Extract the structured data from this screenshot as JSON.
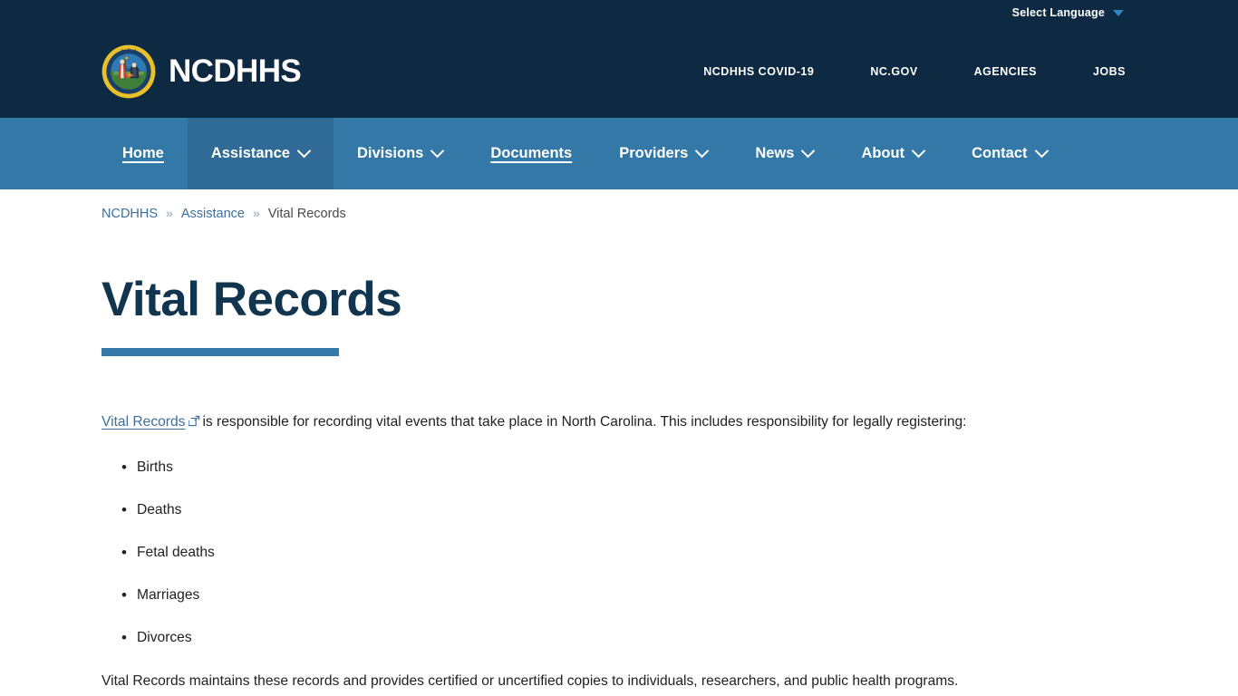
{
  "utility": {
    "language_label": "Select Language",
    "caret_icon": "chevron-down-icon"
  },
  "masthead": {
    "brand_name": "NCDHHS",
    "seal_icon": "north-carolina-state-seal-icon",
    "top_links": [
      {
        "label": "NCDHHS COVID-19"
      },
      {
        "label": "NC.GOV"
      },
      {
        "label": "AGENCIES"
      },
      {
        "label": "JOBS"
      }
    ]
  },
  "mainnav": {
    "items": [
      {
        "label": "Home",
        "has_caret": false,
        "active": false,
        "underline": true
      },
      {
        "label": "Assistance",
        "has_caret": true,
        "active": true,
        "underline": false
      },
      {
        "label": "Divisions",
        "has_caret": true,
        "active": false,
        "underline": false
      },
      {
        "label": "Documents",
        "has_caret": false,
        "active": false,
        "underline": true
      },
      {
        "label": "Providers",
        "has_caret": true,
        "active": false,
        "underline": false
      },
      {
        "label": "News",
        "has_caret": true,
        "active": false,
        "underline": false
      },
      {
        "label": "About",
        "has_caret": true,
        "active": false,
        "underline": false
      },
      {
        "label": "Contact",
        "has_caret": true,
        "active": false,
        "underline": false
      }
    ]
  },
  "breadcrumb": {
    "items": [
      {
        "label": "NCDHHS",
        "is_link": true
      },
      {
        "label": "Assistance",
        "is_link": true
      },
      {
        "label": "Vital Records",
        "is_link": false
      }
    ],
    "separator": "»"
  },
  "main": {
    "title": "Vital Records",
    "intro": {
      "link_text": "Vital Records",
      "external_icon": "external-link-icon",
      "rest": "is responsible for recording vital events that take place in North Carolina. This includes responsibility for legally registering:"
    },
    "bullets": [
      "Births",
      "Deaths",
      "Fetal deaths",
      "Marriages",
      "Divorces"
    ],
    "outro": "Vital Records maintains these records and provides certified or uncertified copies to individuals, researchers, and public health programs."
  },
  "colors": {
    "header_navy": "#0d2a42",
    "nav_blue": "#3478a8",
    "nav_active_blue": "#2f6b96",
    "title_navy": "#12354f",
    "link_blue": "#3d6f9c",
    "seal_gold": "#e8c02a"
  }
}
